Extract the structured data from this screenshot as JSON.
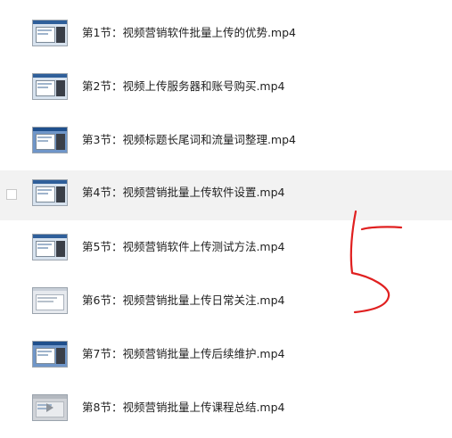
{
  "files": [
    {
      "name": "第1节：视频营销软件批量上传的优势.mp4",
      "thumb_style": "dark"
    },
    {
      "name": "第2节：视频上传服务器和账号购买.mp4",
      "thumb_style": "dark"
    },
    {
      "name": "第3节：视频标题长尾词和流量词整理.mp4",
      "thumb_style": "blue"
    },
    {
      "name": "第4节：视频营销批量上传软件设置.mp4",
      "thumb_style": "dark"
    },
    {
      "name": "第5节：视频营销软件上传测试方法.mp4",
      "thumb_style": "dark"
    },
    {
      "name": "第6节：视频营销批量上传日常关注.mp4",
      "thumb_style": "light"
    },
    {
      "name": "第7节：视频营销批量上传后续维护.mp4",
      "thumb_style": "blue"
    },
    {
      "name": "第8节：视频营销批量上传课程总结.mp4",
      "thumb_style": "gray"
    }
  ],
  "hovered_index": 3,
  "annotation": {
    "digit": "5",
    "color": "#e02020"
  }
}
